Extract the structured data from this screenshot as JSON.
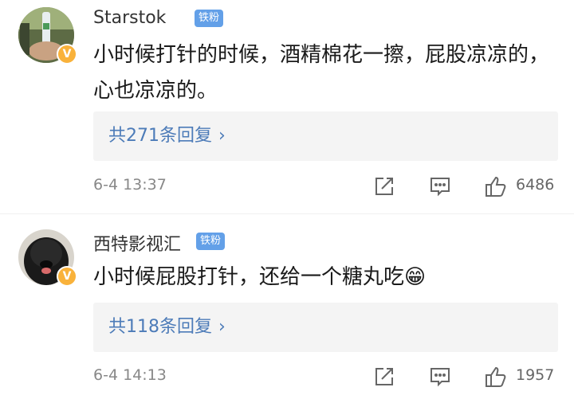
{
  "comments": [
    {
      "username": "Starstok",
      "badge": "铁粉",
      "verified_badge": "V",
      "content": "小时候打针的时候，酒精棉花一擦，屁股凉凉的，心也凉凉的。",
      "replies_label": "共271条回复",
      "timestamp": "6-4 13:37",
      "likes": "6486",
      "icons": [
        "share-icon",
        "comment-icon",
        "like-icon"
      ]
    },
    {
      "username": "西特影视汇",
      "badge": "铁粉",
      "verified_badge": "V",
      "content": "小时候屁股打针，还给一个糖丸吃",
      "emoji": "😁",
      "replies_label": "共118条回复",
      "timestamp": "6-4 14:13",
      "likes": "1957",
      "icons": [
        "share-icon",
        "comment-icon",
        "like-icon"
      ]
    }
  ],
  "colors": {
    "link": "#4c7bb8",
    "badge_bg": "#63a0e8",
    "verified": "#f9b23b",
    "reply_bg": "#f4f4f4",
    "meta_text": "#888888"
  }
}
